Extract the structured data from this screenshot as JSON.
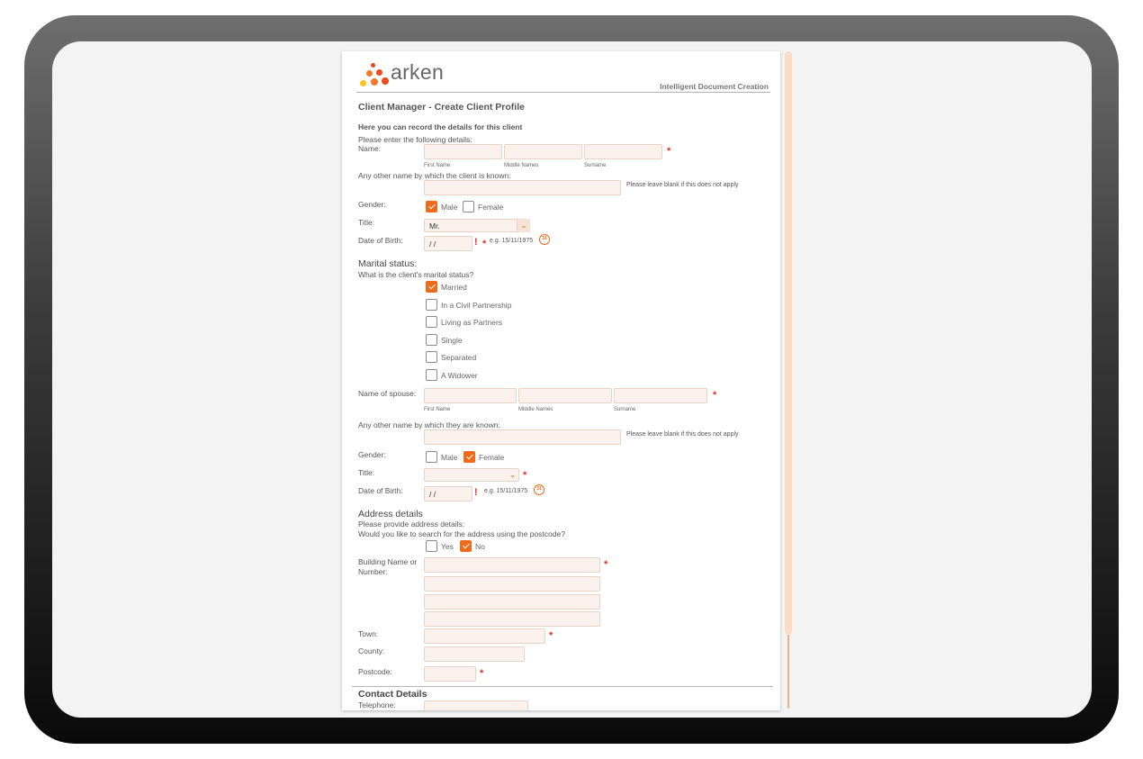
{
  "brand": {
    "logo_text": "arken",
    "tagline": "Intelligent Document Creation",
    "dot_colors": [
      "#e84c1e",
      "#f07a2a",
      "#f7a21b",
      "#fbc312"
    ]
  },
  "form": {
    "title": "Client Manager - Create Client Profile",
    "intro_bold": "Here you can record the details for this client",
    "intro": "Please enter the following details:",
    "name_label": "Name:",
    "first_name_sub": "First Name",
    "middle_names_sub": "Middle Names",
    "surname_sub": "Surname",
    "other_name_label": "Any other name by which the client is known:",
    "leave_blank_note": "Please leave blank if this does not apply",
    "gender_label": "Gender:",
    "male_label": "Male",
    "female_label": "Female",
    "title_label": "Title:",
    "title_value": "Mr.",
    "dob_label": "Date of Birth:",
    "dob_value": "/ /",
    "dob_example": "e.g. 15/11/1975",
    "calendar_glyph": "31",
    "required_mark": "*",
    "invalid_mark": "!",
    "select_arrow": "⌄"
  },
  "marital": {
    "heading": "Marital status:",
    "question": "What is the client's marital status?",
    "options": [
      "Married",
      "In a Civil Partnership",
      "Living as Partners",
      "Single",
      "Separated",
      "A Widower"
    ],
    "selected": "Married"
  },
  "spouse": {
    "name_label": "Name of spouse:",
    "first_name_sub": "First Name",
    "middle_names_sub": "Middle Names",
    "surname_sub": "Surname",
    "other_name_label": "Any other name by which they are known:",
    "leave_blank_note": "Please leave blank if this does not apply",
    "gender_label": "Gender:",
    "male_label": "Male",
    "female_label": "Female",
    "title_label": "Title:",
    "dob_label": "Date of Birth:",
    "dob_value": "/ /",
    "dob_example": "e.g. 15/11/1975"
  },
  "address": {
    "heading": "Address details",
    "intro": "Please provide address details:",
    "postcode_question": "Would you like to search for the address using the postcode?",
    "yes_label": "Yes",
    "no_label": "No",
    "building_label_1": "Building Name or",
    "building_label_2": "Number:",
    "town_label": "Town:",
    "county_label": "County:",
    "postcode_label": "Postcode:"
  },
  "contact": {
    "heading": "Contact Details",
    "telephone_label": "Telephone:"
  }
}
